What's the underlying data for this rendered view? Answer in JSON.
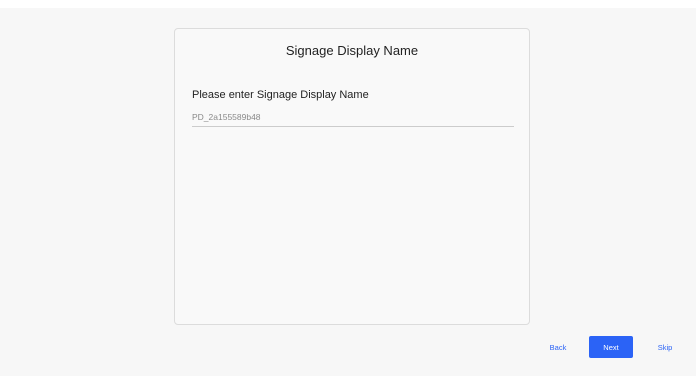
{
  "card": {
    "title": "Signage Display Name",
    "prompt": "Please enter Signage Display Name",
    "name_input_value": "PD_2a155589b48"
  },
  "footer": {
    "back_label": "Back",
    "next_label": "Next",
    "skip_label": "Skip"
  },
  "colors": {
    "accent": "#2b63f6",
    "background": "#f7f7f7",
    "card_border": "#dcdcdc"
  }
}
